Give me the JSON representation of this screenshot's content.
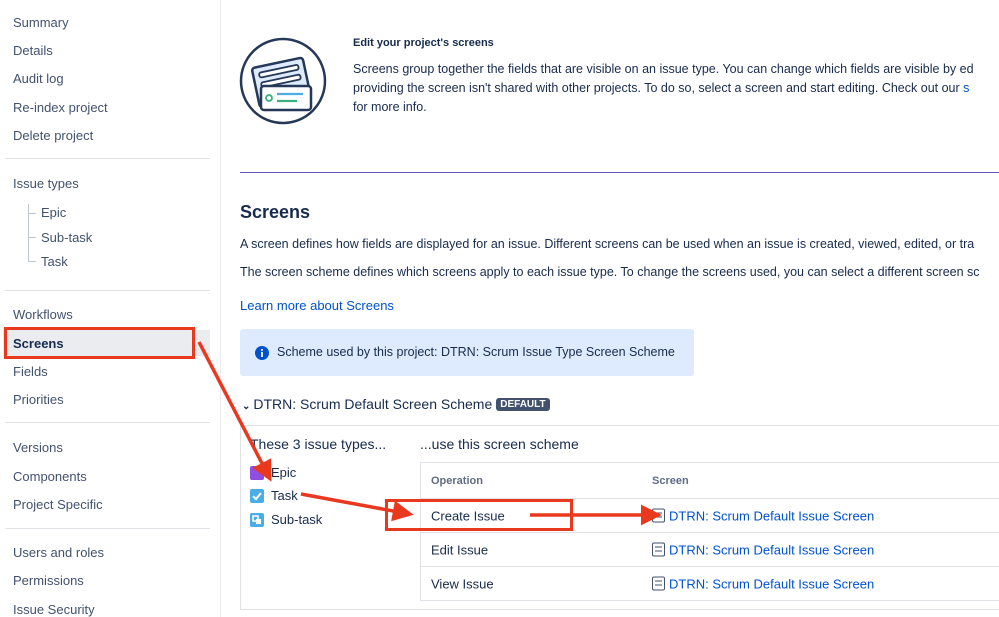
{
  "sidebar": {
    "project_items": [
      "Summary",
      "Details",
      "Audit log",
      "Re-index project",
      "Delete project"
    ],
    "issue_types_label": "Issue types",
    "issue_type_children": [
      "Epic",
      "Sub-task",
      "Task"
    ],
    "config_items": [
      "Workflows",
      "Screens",
      "Fields",
      "Priorities"
    ],
    "version_items": [
      "Versions",
      "Components",
      "Project Specific"
    ],
    "people_items": [
      "Users and roles",
      "Permissions",
      "Issue Security"
    ],
    "selected": "Screens"
  },
  "intro": {
    "heading": "Edit your project's screens",
    "line1": "Screens group together the fields that are visible on an issue type. You can change which fields are visible by ed",
    "line2_a": "providing the screen isn't shared with other projects. To do so, select a screen and start editing. Check out our ",
    "line2_link": "s",
    "line3": "for more info."
  },
  "screens": {
    "title": "Screens",
    "desc1": "A screen defines how fields are displayed for an issue. Different screens can be used when an issue is created, viewed, edited, or tra",
    "desc2": "The screen scheme defines which screens apply to each issue type. To change the screens used, you can select a different screen sc",
    "learn_more": "Learn more about Screens",
    "info_text": "Scheme used by this project: DTRN: Scrum Issue Type Screen Scheme"
  },
  "scheme": {
    "name": "DTRN: Scrum Default Screen Scheme",
    "badge": "DEFAULT",
    "left_heading": "These 3 issue types...",
    "right_heading": "...use this screen scheme",
    "issue_types": [
      "Epic",
      "Task",
      "Sub-task"
    ],
    "columns": {
      "operation": "Operation",
      "screen": "Screen"
    },
    "rows": [
      {
        "operation": "Create Issue",
        "screen": "DTRN: Scrum Default Issue Screen"
      },
      {
        "operation": "Edit Issue",
        "screen": "DTRN: Scrum Default Issue Screen"
      },
      {
        "operation": "View Issue",
        "screen": "DTRN: Scrum Default Issue Screen"
      }
    ]
  },
  "colors": {
    "accent_link": "#0052cc",
    "annotation": "#e8391f",
    "epic": "#904ee2",
    "task": "#4bade8",
    "subtask": "#4bade8",
    "info_bg": "#deebff"
  }
}
